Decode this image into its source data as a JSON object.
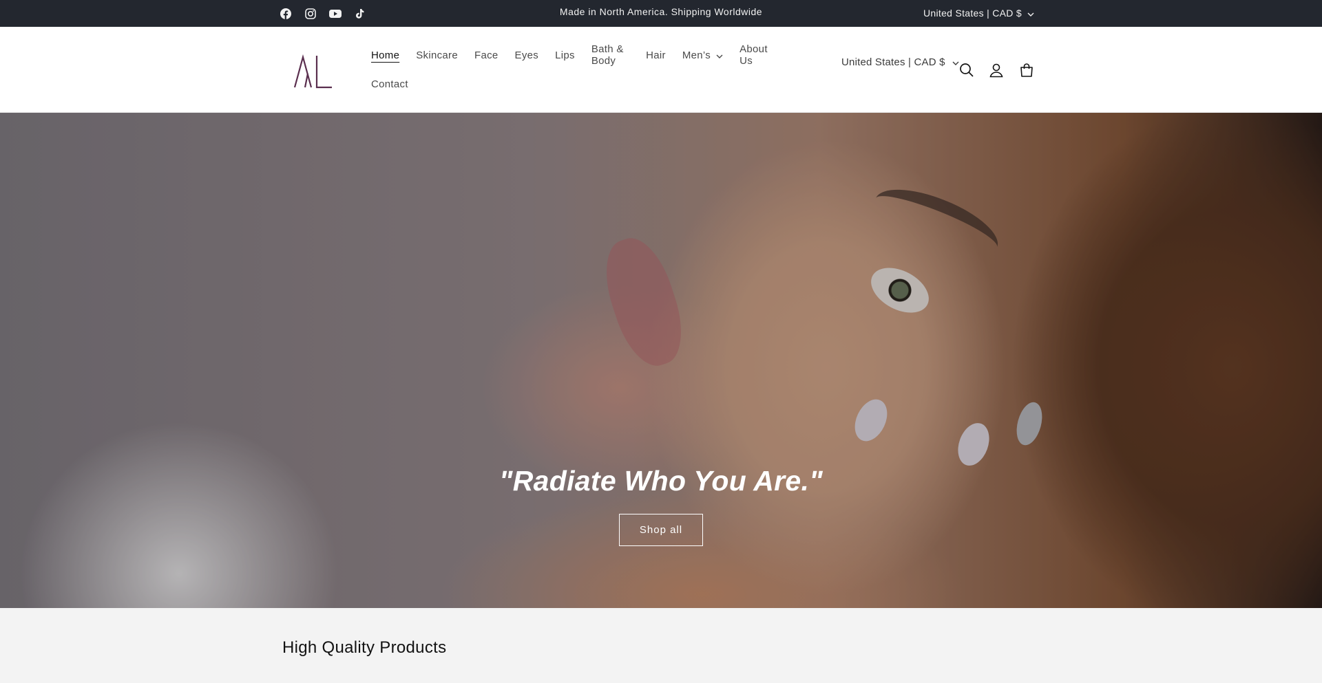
{
  "announcement": {
    "text": "Made in North America. Shipping Worldwide",
    "social_icons": [
      "facebook-icon",
      "instagram-icon",
      "youtube-icon",
      "tiktok-icon"
    ],
    "localization": "United States | CAD $"
  },
  "header": {
    "logo_alt": "AL",
    "nav": [
      "Home",
      "Skincare",
      "Face",
      "Eyes",
      "Lips",
      "Bath & Body",
      "Hair",
      "Men’s",
      "About Us",
      "Contact"
    ],
    "active_nav": "Home",
    "localization": "United States | CAD $",
    "icons": [
      "search-icon",
      "account-icon",
      "cart-icon"
    ]
  },
  "hero": {
    "title": "\"Radiate Who You Are.\"",
    "button": "Shop all"
  },
  "section": {
    "title": "High Quality Products"
  },
  "colors": {
    "announcement_bg": "#23272f",
    "logo": "#5a2e4e",
    "text": "#121212"
  }
}
